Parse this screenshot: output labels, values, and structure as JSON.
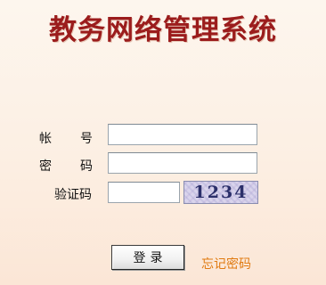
{
  "header": {
    "title": "教务网络管理系统"
  },
  "form": {
    "account": {
      "label_chars": [
        "帐",
        "号"
      ],
      "value": ""
    },
    "password": {
      "label_chars": [
        "密",
        "码"
      ],
      "value": ""
    },
    "captcha": {
      "label": "验证码",
      "value": "",
      "image_text": "1234"
    },
    "login_label": "登录",
    "forgot_label": "忘记密码"
  },
  "colors": {
    "title": "#9b1c1c",
    "forgot_link": "#e07a10",
    "background": "#fcefe3"
  }
}
